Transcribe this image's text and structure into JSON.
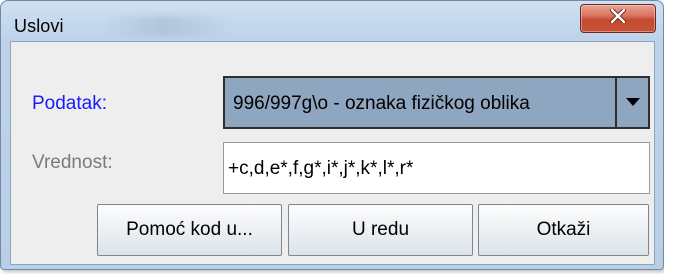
{
  "window": {
    "title": "Uslovi",
    "close_icon": "close-icon",
    "close_color": "#c44a2f"
  },
  "form": {
    "field_label": "Podatak:",
    "field_label_color": "#1a1aff",
    "field_value": "996/997g\\o - oznaka fizičkog oblika",
    "dropdown_icon": "chevron-down-icon",
    "value_label": "Vrednost:",
    "value_text": "+c,d,e*,f,g*,i*,j*,k*,l*,r*"
  },
  "buttons": {
    "help": "Pomoć kod u...",
    "ok": "U redu",
    "cancel": "Otkaži"
  }
}
